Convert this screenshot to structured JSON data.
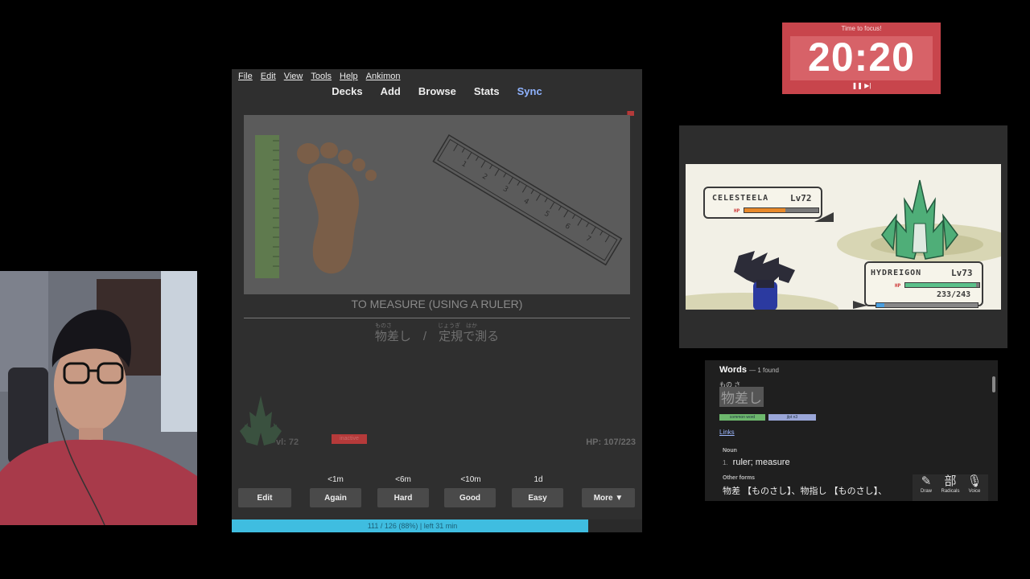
{
  "anki": {
    "menu": [
      "File",
      "Edit",
      "View",
      "Tools",
      "Help",
      "Ankimon"
    ],
    "toolbar": {
      "decks": "Decks",
      "add": "Add",
      "browse": "Browse",
      "stats": "Stats",
      "sync": "Sync"
    },
    "card": {
      "meaning": "TO MEASURE (USING A RULER)",
      "ruby1": "ものさ",
      "ruby2": "じょうぎ　はか",
      "japanese": "物差し　/　定規で測る"
    },
    "ankimon": {
      "level": "vl: 72",
      "status": "inactive",
      "hp": "HP: 107/223"
    },
    "intervals": {
      "again": "<1m",
      "hard": "<6m",
      "good": "<10m",
      "easy": "1d"
    },
    "buttons": {
      "edit": "Edit",
      "again": "Again",
      "hard": "Hard",
      "good": "Good",
      "easy": "Easy",
      "more": "More ▼"
    },
    "progress": {
      "text": "111 / 126 (88%) | left 31 min",
      "fraction": 0.88
    }
  },
  "timer": {
    "title": "Time to focus!",
    "time": "20:20",
    "controls": "❚❚ ▶|"
  },
  "battle": {
    "enemy": {
      "name": "CELESTEELA",
      "level": "Lv72",
      "hp_fraction": 0.55
    },
    "player": {
      "name": "HYDREIGON",
      "level": "Lv73",
      "hp": "233/243",
      "hp_fraction": 0.96,
      "exp_fraction": 0.08
    }
  },
  "dictionary": {
    "header": "Words",
    "found": "— 1 found",
    "furigana": "もの さ",
    "word": "物差し",
    "tags": [
      "common word",
      "jlpt n3"
    ],
    "links": "Links",
    "pos": "Noun",
    "gloss_num": "1.",
    "gloss": "ruler; measure",
    "other_forms_label": "Other forms",
    "other_forms": "物差 【ものさし】、物指し 【ものさし】、",
    "tools": [
      {
        "icon": "✎",
        "label": "Draw"
      },
      {
        "icon": "部",
        "label": "Radicals"
      },
      {
        "icon": "🎙",
        "label": "Voice"
      }
    ]
  },
  "colors": {
    "timer_bg": "#c8454c",
    "progress": "#3fbde0",
    "sync": "#8fb3ff"
  }
}
